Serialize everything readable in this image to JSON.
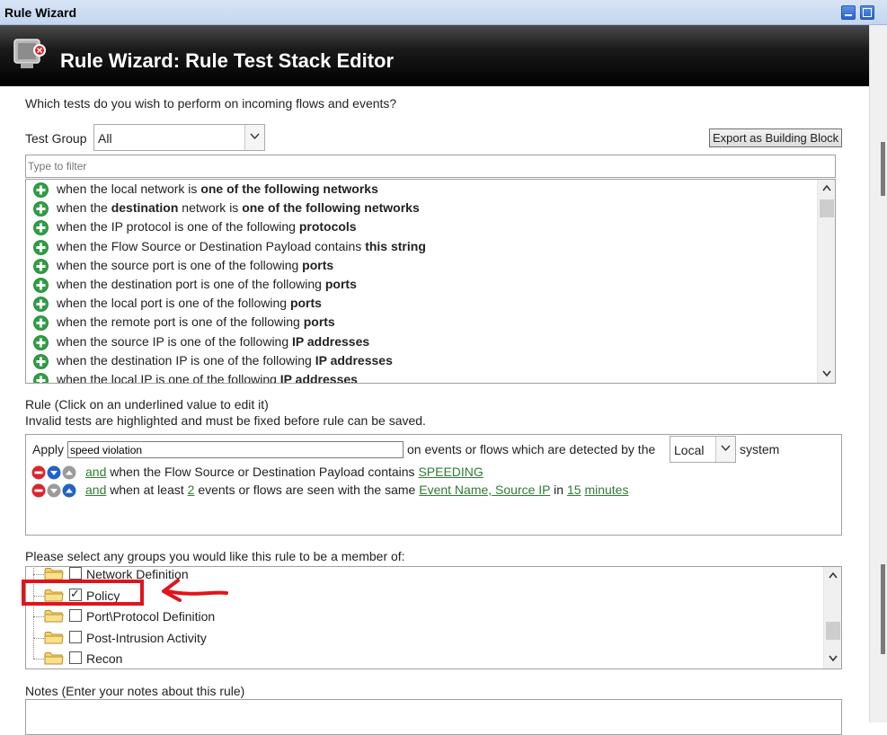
{
  "window": {
    "title": "Rule Wizard"
  },
  "header": {
    "title": "Rule Wizard: Rule Test Stack Editor"
  },
  "tests_prompt": "Which tests do you wish to perform on incoming flows and events?",
  "test_group": {
    "label": "Test Group",
    "value": "All"
  },
  "export_button": "Export as Building Block",
  "filter": {
    "placeholder": "Type to filter"
  },
  "tests": [
    {
      "pre": "when the local network is ",
      "bold": "one of the following networks",
      "post": ""
    },
    {
      "pre": "when the ",
      "bold": "destination",
      "post": " network is ",
      "bold2": "one of the following networks"
    },
    {
      "pre": "when the IP protocol is one of the following ",
      "bold": "protocols",
      "post": ""
    },
    {
      "pre": "when the Flow Source or Destination Payload contains ",
      "bold": "this string",
      "post": ""
    },
    {
      "pre": "when the source port is one of the following ",
      "bold": "ports",
      "post": ""
    },
    {
      "pre": "when the destination port is one of the following ",
      "bold": "ports",
      "post": ""
    },
    {
      "pre": "when the local port is one of the following ",
      "bold": "ports",
      "post": ""
    },
    {
      "pre": "when the remote port is one of the following ",
      "bold": "ports",
      "post": ""
    },
    {
      "pre": "when the source IP is one of the following ",
      "bold": "IP addresses",
      "post": ""
    },
    {
      "pre": "when the destination IP is one of the following ",
      "bold": "IP addresses",
      "post": ""
    },
    {
      "pre": "when the local IP is one of the following ",
      "bold": "IP addresses",
      "post": ""
    }
  ],
  "rule_section": {
    "line1": "Rule (Click on an underlined value to edit it)",
    "line2": "Invalid tests are highlighted and must be fixed before rule can be saved."
  },
  "rule": {
    "apply_label": "Apply",
    "name_value": "speed violation",
    "on_events_text": "on events or flows which are detected by the",
    "system_value": "Local",
    "system_label": "system",
    "conditions": [
      {
        "and": "and",
        "text": " when the Flow Source or Destination Payload contains ",
        "link1": "SPEEDING"
      },
      {
        "and": "and",
        "text": " when at least ",
        "link1": "2",
        "mid1": " events or flows are seen with the same ",
        "link2": "Event Name, Source IP",
        "mid2": " in ",
        "link3": "15",
        "link4": "minutes"
      }
    ]
  },
  "groups_prompt": "Please select any groups you would like this rule to be a member of:",
  "groups": [
    {
      "label": "Network Definition",
      "checked": false
    },
    {
      "label": "Policy",
      "checked": true
    },
    {
      "label": "Port\\Protocol Definition",
      "checked": false
    },
    {
      "label": "Post-Intrusion Activity",
      "checked": false
    },
    {
      "label": "Recon",
      "checked": false
    }
  ],
  "notes_label": "Notes (Enter your notes about this rule)",
  "colors": {
    "link": "#2e7d32",
    "annotation": "#e0151b",
    "add_icon": "#2ea043"
  }
}
